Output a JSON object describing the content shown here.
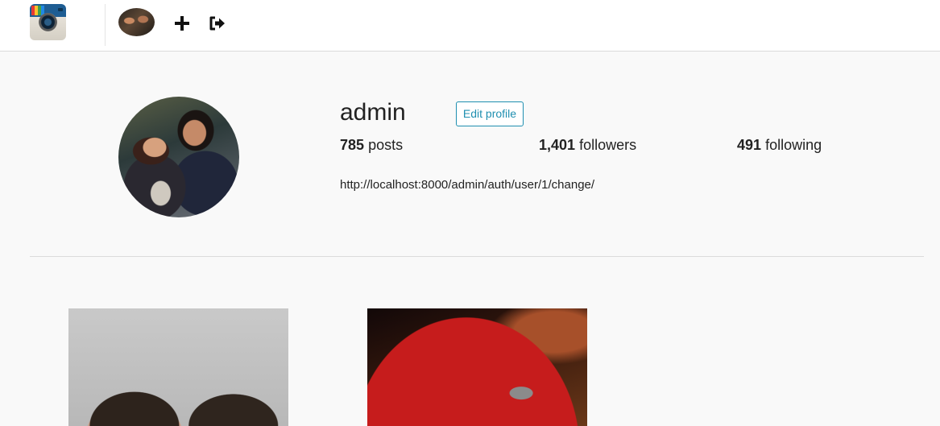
{
  "nav": {
    "logo_icon": "camera-logo-icon",
    "avatar_icon": "user-avatar",
    "add_icon": "plus-icon",
    "logout_icon": "sign-out-icon"
  },
  "profile": {
    "username": "admin",
    "edit_label": "Edit profile",
    "posts_count": "785",
    "posts_label": "posts",
    "followers_count": "1,401",
    "followers_label": "followers",
    "following_count": "491",
    "following_label": "following",
    "bio_url": "http://localhost:8000/admin/auth/user/1/change/"
  },
  "posts": [
    {
      "kind": "photo",
      "subject": "selfie"
    },
    {
      "kind": "photo",
      "subject": "red car"
    }
  ],
  "colors": {
    "accent": "#1f8fb0",
    "background": "#f9f9f9",
    "border": "#dbdbdb"
  }
}
